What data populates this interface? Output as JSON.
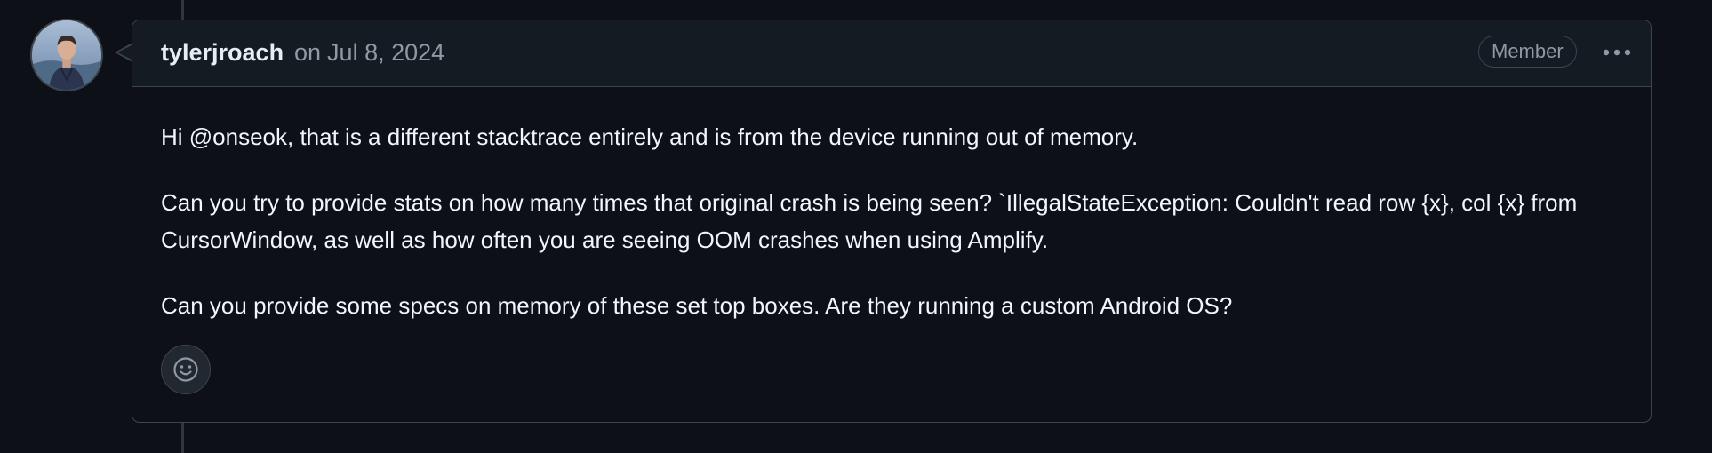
{
  "comment": {
    "author": "tylerjroach",
    "date_prefix": "on",
    "date": "Jul 8, 2024",
    "role_badge": "Member",
    "more_options_icon": "kebab-horizontal-icon",
    "avatar_icon": "user-avatar",
    "body": [
      "Hi @onseok, that is a different stacktrace entirely and is from the device running out of memory.",
      "Can you try to provide stats on how many times that original crash is being seen? `IllegalStateException: Couldn't read row {x}, col {x} from CursorWindow, as well as how often you are seeing OOM crashes when using Amplify.",
      "Can you provide some specs on memory of these set top boxes. Are they running a custom Android OS?"
    ],
    "reaction_icon": "smiley-icon"
  },
  "colors": {
    "background": "#0d1117",
    "header_background": "#151b23",
    "border": "#3d444d",
    "text_primary": "#f0f6fc",
    "text_muted": "#9198a1"
  }
}
